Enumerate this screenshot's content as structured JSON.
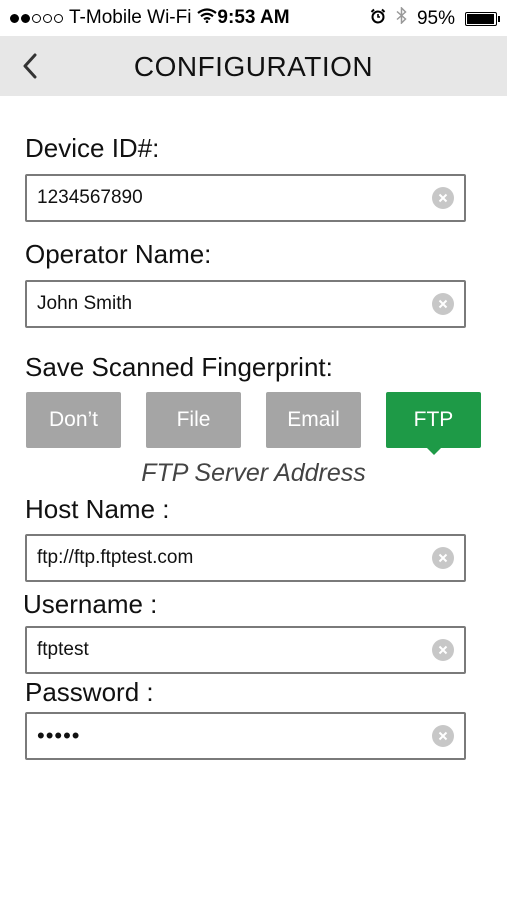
{
  "status_bar": {
    "carrier": "T-Mobile Wi-Fi",
    "time": "9:53 AM",
    "battery_percent": "95%",
    "battery_level": 0.95,
    "signal_bars_filled": 2,
    "signal_bars_total": 5
  },
  "nav": {
    "title": "CONFIGURATION",
    "back_icon": "chevron-left-icon"
  },
  "form": {
    "device_id_label": "Device ID#:",
    "device_id_value": "1234567890",
    "operator_name_label": "Operator Name:",
    "operator_name_value": "John Smith",
    "save_label": "Save Scanned Fingerprint:",
    "save_options": [
      "Don’t",
      "File",
      "Email",
      "FTP"
    ],
    "save_selected": "FTP",
    "ftp_caption": "FTP Server Address",
    "host_label": "Host Name :",
    "host_value": "ftp://ftp.ftptest.com",
    "username_label": "Username :",
    "username_value": "ftptest",
    "password_label": "Password :",
    "password_value": "•••••"
  },
  "colors": {
    "accent": "#1e9a47",
    "inactive_button": "#a5a5a5",
    "nav_background": "#e7e7e7"
  }
}
